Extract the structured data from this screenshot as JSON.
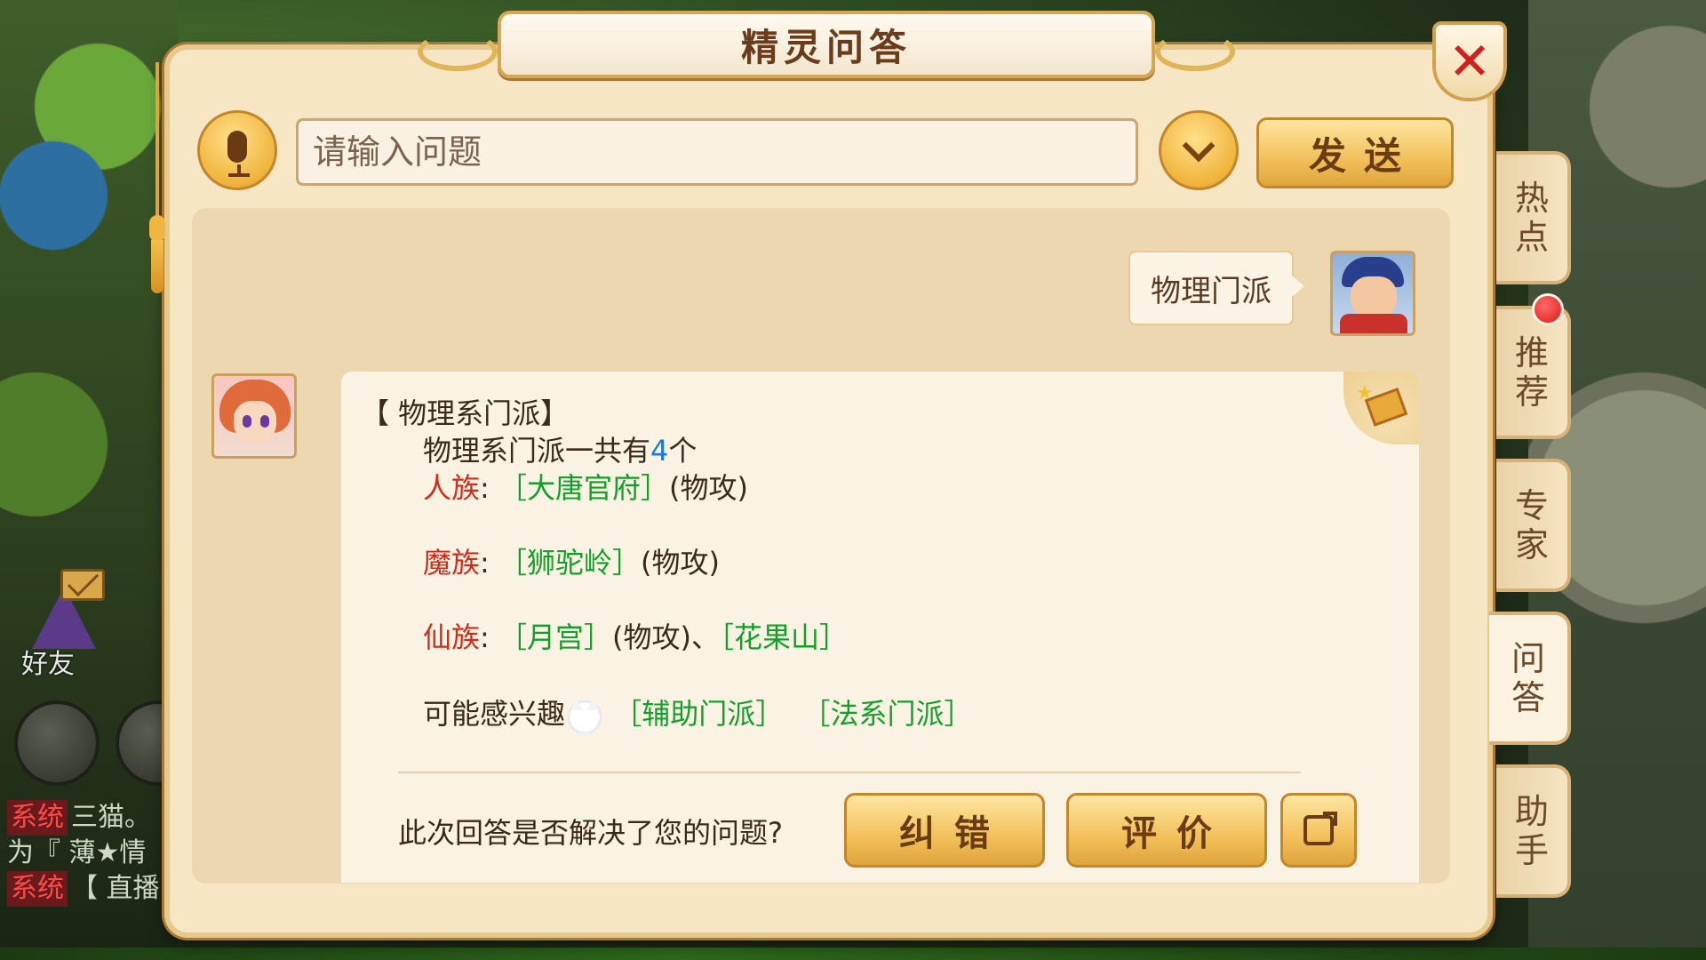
{
  "dialog": {
    "title": "精灵问答",
    "close_symbol": "✕"
  },
  "input": {
    "placeholder": "请输入问题",
    "value": "",
    "send_label": "发送"
  },
  "conversation": {
    "user_message": "物理门派",
    "answer": {
      "title": "【 物理系门派】",
      "intro_prefix": "物理系门派一共有",
      "count": "4",
      "intro_suffix": "个",
      "rows": [
        {
          "race": "人族",
          "sep": ": ",
          "items": [
            {
              "text": "［大唐官府］",
              "type": "link"
            },
            {
              "text": "(物攻)",
              "type": "plain"
            }
          ]
        },
        {
          "race": "魔族",
          "sep": ": ",
          "items": [
            {
              "text": "［狮驼岭］",
              "type": "link"
            },
            {
              "text": "(物攻)",
              "type": "plain"
            }
          ]
        },
        {
          "race": "仙族",
          "sep": ": ",
          "items": [
            {
              "text": "［月宫］",
              "type": "link"
            },
            {
              "text": "(物攻)、",
              "type": "plain"
            },
            {
              "text": "［花果山］",
              "type": "link"
            }
          ]
        }
      ],
      "interest_label": "可能感兴趣",
      "interest_links": [
        "［辅助门派］",
        "［法系门派］"
      ]
    },
    "feedback_question": "此次回答是否解决了您的问题?",
    "correct_label": "纠错",
    "rate_label": "评价"
  },
  "side_tabs": [
    {
      "label": "热点",
      "active": false
    },
    {
      "label": "推荐",
      "active": false,
      "badge": true
    },
    {
      "label": "专家",
      "active": false
    },
    {
      "label": "问答",
      "active": true
    },
    {
      "label": "助手",
      "active": false
    }
  ],
  "background": {
    "friend_label": "好友",
    "chat_lines": [
      {
        "tag": "系统",
        "text": "三猫。"
      },
      {
        "tag": "",
        "text": "为『 薄★情"
      },
      {
        "tag": "系统",
        "text": "【 直播"
      }
    ]
  },
  "colors": {
    "race_red": "#d42a1a",
    "link_green": "#12a02a",
    "count_blue": "#1a7ad8",
    "button_gold": "#f2c05a"
  }
}
